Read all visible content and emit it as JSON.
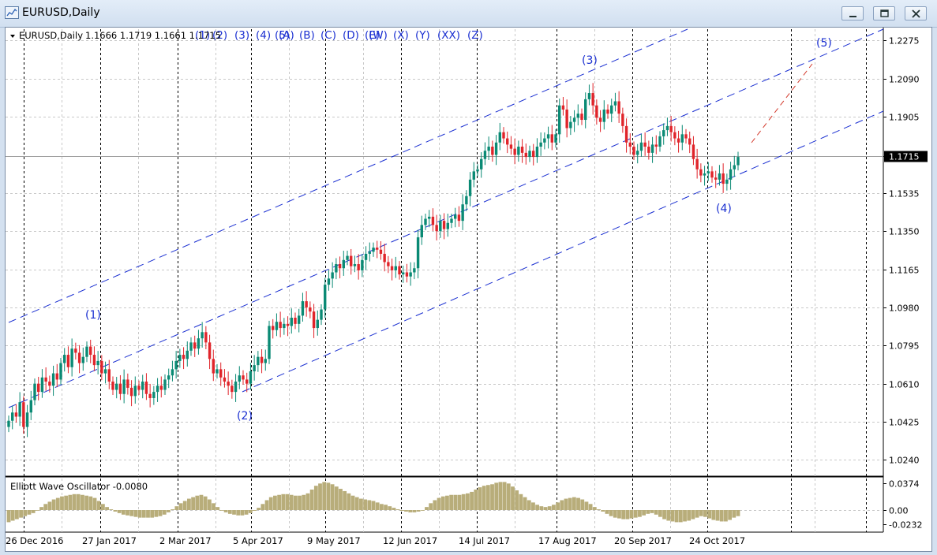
{
  "window": {
    "title": "EURUSD,Daily",
    "icon": "chart-window-icon",
    "buttons": [
      "minimize-icon",
      "restore-icon",
      "close-icon"
    ]
  },
  "chart_data": {
    "type": "candlestick",
    "symbol_header": "EURUSD,Daily",
    "ohlc_text": "1.1666 1.1719 1.1661 1.1715",
    "header_wave_labels": [
      "(1)",
      "(2)",
      "(3)",
      "(4)",
      "(5)",
      "(A)",
      "(B)",
      "(C)",
      "(D)",
      "(E)",
      "(W)",
      "(X)",
      "(Y)",
      "(XX)",
      "(Z)"
    ],
    "current_price": "1.1715",
    "y_ticks": [
      "1.2275",
      "1.2090",
      "1.1905",
      "1.1715",
      "1.1535",
      "1.1350",
      "1.1165",
      "1.0980",
      "1.0795",
      "1.0610",
      "1.0425",
      "1.0240"
    ],
    "x_ticks": [
      "26 Dec 2016",
      "27 Jan 2017",
      "2 Mar 2017",
      "5 Apr 2017",
      "9 May 2017",
      "12 Jun 2017",
      "14 Jul 2017",
      "17 Aug 2017",
      "20 Sep 2017",
      "24 Oct 2017"
    ],
    "wave_labels": [
      {
        "text": "(1)",
        "x": "27 Jan 2017",
        "y": 1.093
      },
      {
        "text": "(2)",
        "x": "5 Apr 2017",
        "y": 1.048
      },
      {
        "text": "(3)",
        "x": "17 Aug 2017",
        "y": 1.216
      },
      {
        "text": "(4)",
        "x": "24 Oct 2017",
        "y": 1.157
      },
      {
        "text": "(5)",
        "x": "Dec 2017",
        "y": 1.224
      }
    ],
    "closes": [
      1.043,
      1.047,
      1.045,
      1.052,
      1.04,
      1.047,
      1.053,
      1.061,
      1.057,
      1.064,
      1.062,
      1.06,
      1.066,
      1.063,
      1.071,
      1.075,
      1.069,
      1.078,
      1.076,
      1.071,
      1.074,
      1.079,
      1.075,
      1.07,
      1.072,
      1.066,
      1.068,
      1.062,
      1.058,
      1.061,
      1.056,
      1.063,
      1.059,
      1.055,
      1.06,
      1.058,
      1.062,
      1.056,
      1.054,
      1.057,
      1.06,
      1.058,
      1.063,
      1.065,
      1.068,
      1.072,
      1.075,
      1.073,
      1.077,
      1.081,
      1.078,
      1.083,
      1.086,
      1.081,
      1.073,
      1.066,
      1.068,
      1.064,
      1.062,
      1.06,
      1.057,
      1.062,
      1.065,
      1.063,
      1.061,
      1.067,
      1.07,
      1.074,
      1.071,
      1.073,
      1.089,
      1.087,
      1.091,
      1.088,
      1.09,
      1.089,
      1.093,
      1.09,
      1.094,
      1.101,
      1.098,
      1.096,
      1.088,
      1.092,
      1.097,
      1.109,
      1.112,
      1.115,
      1.119,
      1.117,
      1.121,
      1.123,
      1.118,
      1.119,
      1.116,
      1.121,
      1.124,
      1.125,
      1.127,
      1.126,
      1.124,
      1.12,
      1.118,
      1.116,
      1.118,
      1.114,
      1.115,
      1.113,
      1.115,
      1.117,
      1.132,
      1.138,
      1.141,
      1.142,
      1.138,
      1.135,
      1.14,
      1.136,
      1.139,
      1.141,
      1.143,
      1.14,
      1.148,
      1.152,
      1.16,
      1.164,
      1.165,
      1.17,
      1.174,
      1.176,
      1.172,
      1.178,
      1.183,
      1.18,
      1.177,
      1.175,
      1.172,
      1.176,
      1.173,
      1.171,
      1.174,
      1.171,
      1.176,
      1.178,
      1.18,
      1.182,
      1.178,
      1.182,
      1.196,
      1.194,
      1.185,
      1.188,
      1.19,
      1.192,
      1.189,
      1.199,
      1.202,
      1.196,
      1.19,
      1.188,
      1.194,
      1.192,
      1.196,
      1.198,
      1.192,
      1.186,
      1.178,
      1.176,
      1.172,
      1.174,
      1.178,
      1.176,
      1.173,
      1.177,
      1.176,
      1.181,
      1.184,
      1.186,
      1.183,
      1.18,
      1.178,
      1.182,
      1.18,
      1.177,
      1.17,
      1.165,
      1.162,
      1.163,
      1.164,
      1.161,
      1.16,
      1.163,
      1.158,
      1.16,
      1.165,
      1.167,
      1.171
    ],
    "oscillator": {
      "label": "Elliott Wave Oscillator -0.0080",
      "y_ticks": [
        "0.0374",
        "0.00",
        "-0.0232"
      ],
      "values": [
        -0.016,
        -0.014,
        -0.012,
        -0.01,
        -0.008,
        -0.006,
        -0.004,
        0.0,
        0.004,
        0.008,
        0.011,
        0.014,
        0.016,
        0.018,
        0.019,
        0.02,
        0.021,
        0.021,
        0.02,
        0.019,
        0.018,
        0.016,
        0.012,
        0.008,
        0.004,
        0.001,
        -0.002,
        -0.004,
        -0.006,
        -0.007,
        -0.008,
        -0.009,
        -0.01,
        -0.01,
        -0.01,
        -0.01,
        -0.009,
        -0.008,
        -0.006,
        -0.003,
        0.001,
        0.005,
        0.009,
        0.012,
        0.015,
        0.017,
        0.019,
        0.02,
        0.018,
        0.014,
        0.009,
        0.004,
        0.0,
        -0.003,
        -0.005,
        -0.006,
        -0.007,
        -0.007,
        -0.006,
        -0.004,
        -0.001,
        0.003,
        0.008,
        0.013,
        0.017,
        0.019,
        0.02,
        0.021,
        0.021,
        0.02,
        0.019,
        0.019,
        0.02,
        0.022,
        0.027,
        0.032,
        0.035,
        0.037,
        0.036,
        0.034,
        0.031,
        0.028,
        0.025,
        0.022,
        0.019,
        0.017,
        0.015,
        0.014,
        0.013,
        0.012,
        0.01,
        0.008,
        0.007,
        0.005,
        0.003,
        0.001,
        -0.001,
        -0.002,
        -0.003,
        -0.003,
        -0.002,
        0.0,
        0.004,
        0.009,
        0.013,
        0.016,
        0.018,
        0.019,
        0.02,
        0.02,
        0.02,
        0.021,
        0.022,
        0.024,
        0.027,
        0.03,
        0.032,
        0.033,
        0.034,
        0.036,
        0.037,
        0.037,
        0.035,
        0.031,
        0.026,
        0.021,
        0.017,
        0.013,
        0.01,
        0.007,
        0.005,
        0.004,
        0.005,
        0.007,
        0.01,
        0.013,
        0.015,
        0.016,
        0.017,
        0.016,
        0.014,
        0.011,
        0.008,
        0.004,
        0.001,
        -0.002,
        -0.005,
        -0.008,
        -0.01,
        -0.011,
        -0.012,
        -0.012,
        -0.011,
        -0.01,
        -0.009,
        -0.007,
        -0.005,
        -0.004,
        -0.006,
        -0.009,
        -0.012,
        -0.014,
        -0.015,
        -0.016,
        -0.016,
        -0.015,
        -0.014,
        -0.012,
        -0.01,
        -0.008,
        -0.009,
        -0.011,
        -0.013,
        -0.014,
        -0.015,
        -0.015,
        -0.013,
        -0.01,
        -0.008
      ]
    },
    "colors": {
      "up": "#0a8a74",
      "down": "#e0242a",
      "channel": "#1a2fd1",
      "text_blue": "#1a2fd1",
      "osc": "#b8ad7a",
      "forecast": "#d33a2c"
    }
  }
}
